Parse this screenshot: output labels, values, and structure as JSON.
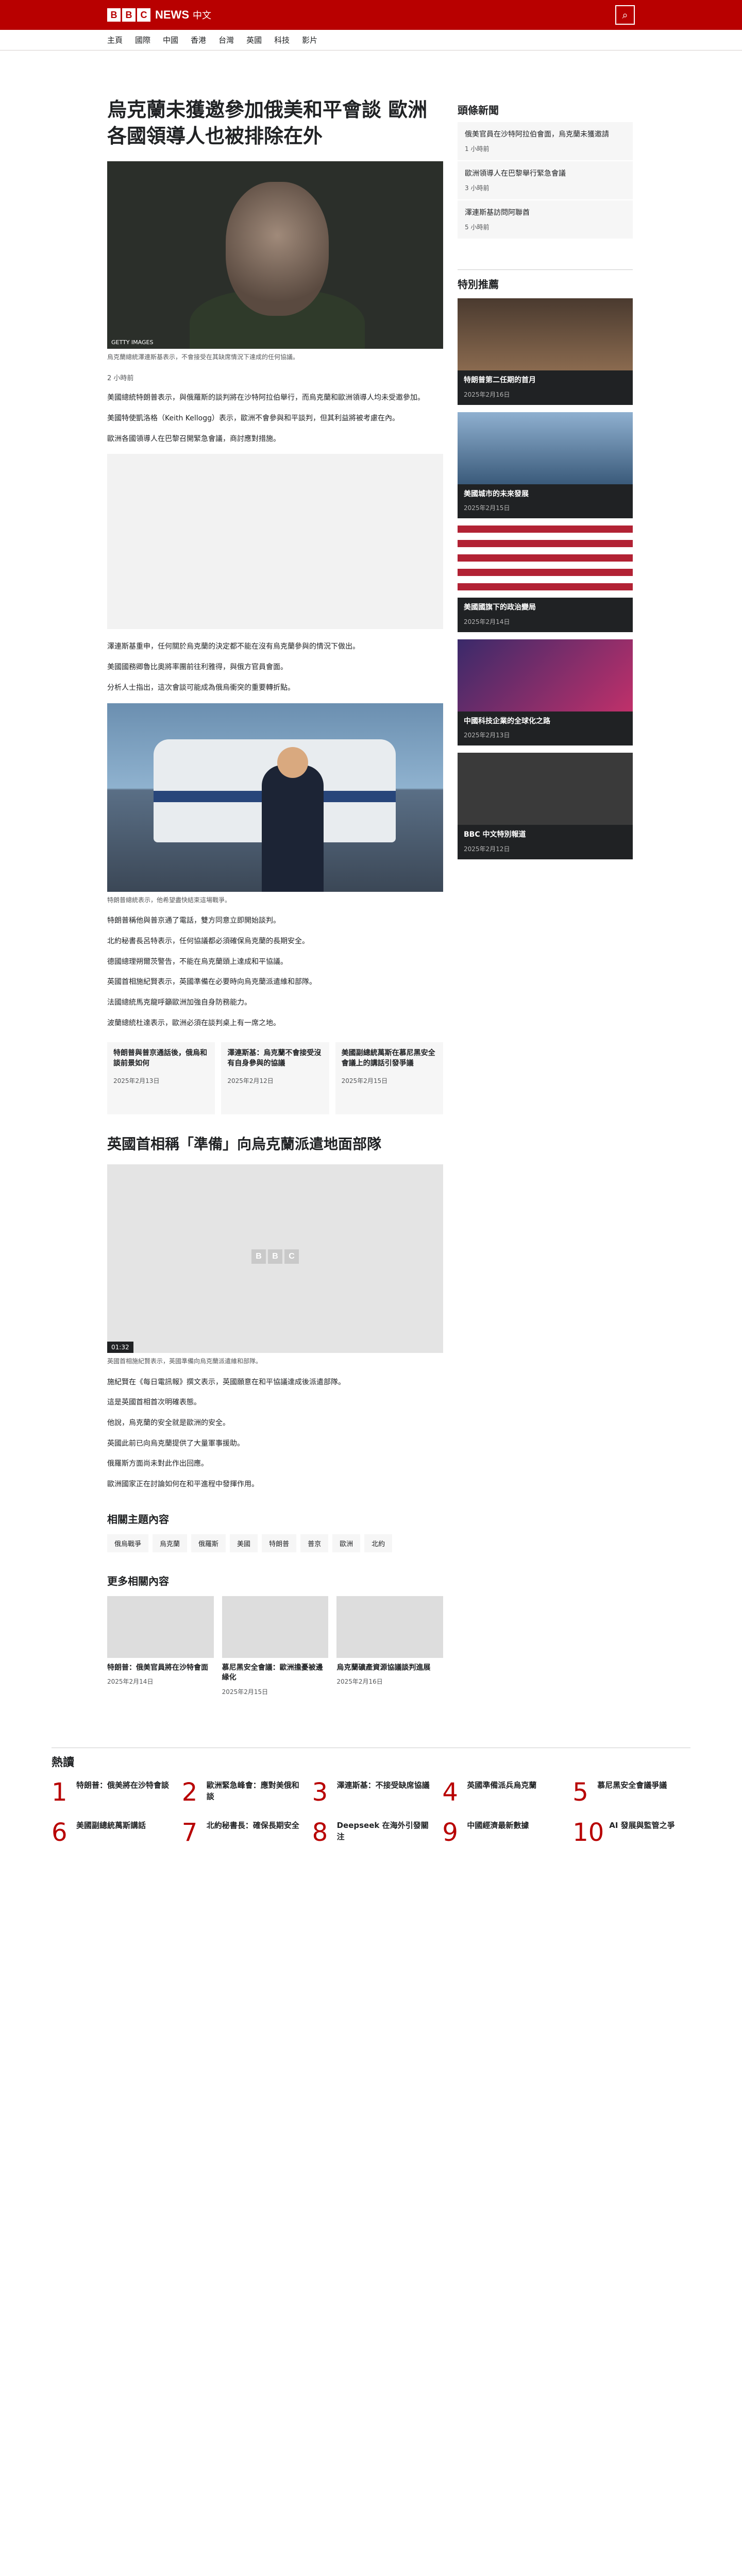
{
  "header": {
    "logo_letters": [
      "B",
      "B",
      "C"
    ],
    "brand": "NEWS",
    "lang": "中文",
    "nav": [
      "主頁",
      "國際",
      "中國",
      "香港",
      "台灣",
      "英國",
      "科技",
      "影片"
    ]
  },
  "article": {
    "title": "烏克蘭未獲邀參加俄美和平會談 歐洲各國領導人也被排除在外",
    "hero_credit": "GETTY IMAGES",
    "hero_caption": "烏克蘭總統澤連斯基表示，不會接受在其缺席情況下達成的任何協議。",
    "byline": "2 小時前",
    "paragraphs": [
      "美國總統特朗普表示，與俄羅斯的談判將在沙特阿拉伯舉行，而烏克蘭和歐洲領導人均未受邀參加。",
      "美國特使凱洛格（Keith Kellogg）表示，歐洲不會參與和平談判，但其利益將被考慮在內。",
      "歐洲各國領導人在巴黎召開緊急會議，商討應對措施。",
      "澤連斯基重申，任何關於烏克蘭的決定都不能在沒有烏克蘭參與的情況下做出。",
      "美國國務卿魯比奧將率團前往利雅得，與俄方官員會面。",
      "分析人士指出，這次會談可能成為俄烏衝突的重要轉折點。"
    ],
    "photo2_caption": "特朗普總統表示，他希望盡快結束這場戰爭。",
    "paragraphs2": [
      "特朗普稱他與普京通了電話，雙方同意立即開始談判。",
      "北約秘書長呂特表示，任何協議都必須確保烏克蘭的長期安全。",
      "德國總理朔爾茨警告，不能在烏克蘭頭上達成和平協議。",
      "英國首相施紀賢表示，英國準備在必要時向烏克蘭派遣維和部隊。",
      "法國總統馬克龍呼籲歐洲加強自身防務能力。",
      "波蘭總統杜達表示，歐洲必須在談判桌上有一席之地。"
    ],
    "related_cards": [
      {
        "title": "特朗普與普京通話後，俄烏和談前景如何",
        "date": "2025年2月13日"
      },
      {
        "title": "澤連斯基：烏克蘭不會接受沒有自身參與的協議",
        "date": "2025年2月12日"
      },
      {
        "title": "美國副總統萬斯在慕尼黑安全會議上的講話引發爭議",
        "date": "2025年2月15日"
      }
    ]
  },
  "video_section": {
    "title": "英國首相稱「準備」向烏克蘭派遣地面部隊",
    "duration": "01:32",
    "caption": "英國首相施紀賢表示，英國準備向烏克蘭派遣維和部隊。",
    "paragraphs": [
      "施紀賢在《每日電訊報》撰文表示，英國願意在和平協議達成後派遣部隊。",
      "這是英國首相首次明確表態。",
      "他說，烏克蘭的安全就是歐洲的安全。",
      "英國此前已向烏克蘭提供了大量軍事援助。",
      "俄羅斯方面尚未對此作出回應。",
      "歐洲國家正在討論如何在和平進程中發揮作用。"
    ]
  },
  "related_topics": {
    "heading": "相關主題內容",
    "tags": [
      "俄烏戰爭",
      "烏克蘭",
      "俄羅斯",
      "美國",
      "特朗普",
      "普京",
      "歐洲",
      "北約"
    ]
  },
  "more_stories": {
    "heading": "更多相關內容",
    "items": [
      {
        "title": "特朗普：俄美官員將在沙特會面",
        "date": "2025年2月14日"
      },
      {
        "title": "慕尼黑安全會議：歐洲擔憂被邊緣化",
        "date": "2025年2月15日"
      },
      {
        "title": "烏克蘭礦產資源協議談判進展",
        "date": "2025年2月16日"
      }
    ]
  },
  "sidebar": {
    "breaking_heading": "頭條新聞",
    "breaking": [
      {
        "title": "俄美官員在沙特阿拉伯會面，烏克蘭未獲邀請",
        "date": "1 小時前"
      },
      {
        "title": "歐洲領導人在巴黎舉行緊急會議",
        "date": "3 小時前"
      },
      {
        "title": "澤連斯基訪問阿聯酋",
        "date": "5 小時前"
      }
    ],
    "featured_heading": "特別推薦",
    "featured": [
      {
        "title": "特朗普第二任期的首月",
        "date": "2025年2月16日"
      },
      {
        "title": "美國城市的未來發展",
        "date": "2025年2月15日"
      },
      {
        "title": "美國國旗下的政治變局",
        "date": "2025年2月14日"
      },
      {
        "title": "中國科技企業的全球化之路",
        "date": "2025年2月13日"
      },
      {
        "title": "BBC 中文特別報道",
        "date": "2025年2月12日"
      }
    ]
  },
  "popular": {
    "heading": "熱讀",
    "items": [
      "特朗普：俄美將在沙特會談",
      "歐洲緊急峰會：應對美俄和談",
      "澤連斯基：不接受缺席協議",
      "英國準備派兵烏克蘭",
      "慕尼黑安全會議爭議",
      "美國副總統萬斯講話",
      "北約秘書長：確保長期安全",
      "Deepseek 在海外引發關注",
      "中國經濟最新數據",
      "AI 發展與監管之爭"
    ]
  },
  "colors": {
    "brand_red": "#b80000",
    "text": "#202224",
    "muted": "#545658"
  }
}
